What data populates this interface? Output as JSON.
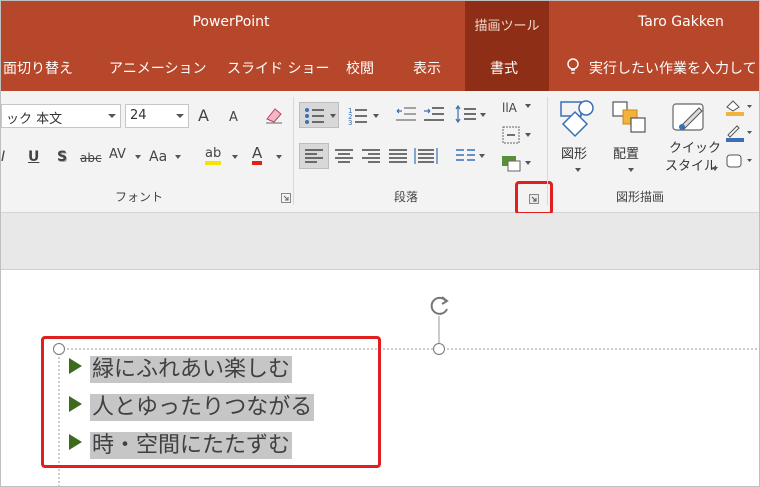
{
  "titlebar": {
    "app_title": "PowerPoint",
    "context_group": "描画ツール",
    "user": "Taro Gakken"
  },
  "tabs": [
    {
      "label": "面切り替え"
    },
    {
      "label": "アニメーション"
    },
    {
      "label": "スライド ショー"
    },
    {
      "label": "校閲"
    },
    {
      "label": "表示"
    },
    {
      "label": "書式",
      "active": true
    }
  ],
  "tell_me": "実行したい作業を入力してく",
  "ribbon": {
    "font": {
      "group_label": "フォント",
      "font_name": "ック 本文",
      "font_size": "24",
      "grow": "A",
      "shrink": "A",
      "bold_partial": "I",
      "underline": "U",
      "shadow": "S",
      "strike": "abc",
      "spacing": "AV",
      "case": "Aa",
      "highlight": "ab",
      "color": "A"
    },
    "paragraph": {
      "group_label": "段落"
    },
    "drawing": {
      "group_label": "図形描画",
      "shapes_label": "図形",
      "arrange_label": "配置",
      "quick_style_label_1": "クイック",
      "quick_style_label_2": "スタイル"
    }
  },
  "slide": {
    "bullets": [
      "緑にふれあい楽しむ",
      "人とゆったりつながる",
      "時・空間にたたずむ"
    ]
  },
  "colors": {
    "titlebar": "#b7472a",
    "context_tab": "#8f2e17",
    "highlight_box": "#e02020",
    "bullet_arrow": "#3d6b1e"
  }
}
